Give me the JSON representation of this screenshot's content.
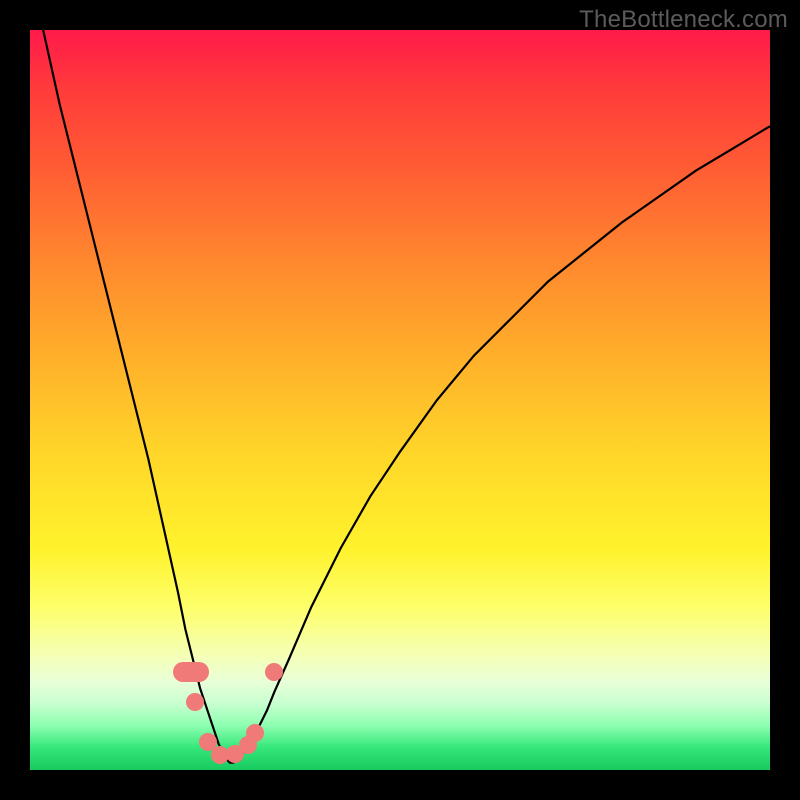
{
  "watermark": "TheBottleneck.com",
  "colors": {
    "frame": "#000000",
    "curve_stroke": "#000000",
    "marker": "#ef7a77",
    "gradient_top": "#ff1a4a",
    "gradient_bottom": "#18c95f"
  },
  "chart_data": {
    "type": "line",
    "title": "",
    "xlabel": "",
    "ylabel": "",
    "xlim": [
      0,
      100
    ],
    "ylim": [
      0,
      100
    ],
    "grid": false,
    "legend": false,
    "x": [
      0,
      2,
      4,
      6,
      8,
      10,
      12,
      14,
      16,
      18,
      20,
      21,
      22,
      23,
      24,
      25,
      25.5,
      26,
      26.5,
      27,
      27.5,
      28,
      29,
      30,
      31,
      32,
      33,
      35,
      38,
      42,
      46,
      50,
      55,
      60,
      65,
      70,
      75,
      80,
      85,
      90,
      95,
      100
    ],
    "y": [
      108,
      99,
      90,
      82,
      74,
      66,
      58,
      50,
      42,
      33,
      24,
      19,
      15,
      11,
      8,
      5,
      3.5,
      2.5,
      1.5,
      1,
      1,
      1.5,
      2.5,
      4,
      6,
      8,
      10.5,
      15,
      22,
      30,
      37,
      43,
      50,
      56,
      61,
      66,
      70,
      74,
      77.5,
      81,
      84,
      87
    ],
    "marker_points": [
      {
        "x": 21.7,
        "y": 13.3,
        "shape": "capsule"
      },
      {
        "x": 22.3,
        "y": 9.2,
        "shape": "dot"
      },
      {
        "x": 24.0,
        "y": 3.8,
        "shape": "dot"
      },
      {
        "x": 25.7,
        "y": 2.0,
        "shape": "dot"
      },
      {
        "x": 27.7,
        "y": 2.1,
        "shape": "dot"
      },
      {
        "x": 29.4,
        "y": 3.4,
        "shape": "dot"
      },
      {
        "x": 30.4,
        "y": 5.0,
        "shape": "dot"
      },
      {
        "x": 33.0,
        "y": 13.3,
        "shape": "dot"
      }
    ]
  }
}
